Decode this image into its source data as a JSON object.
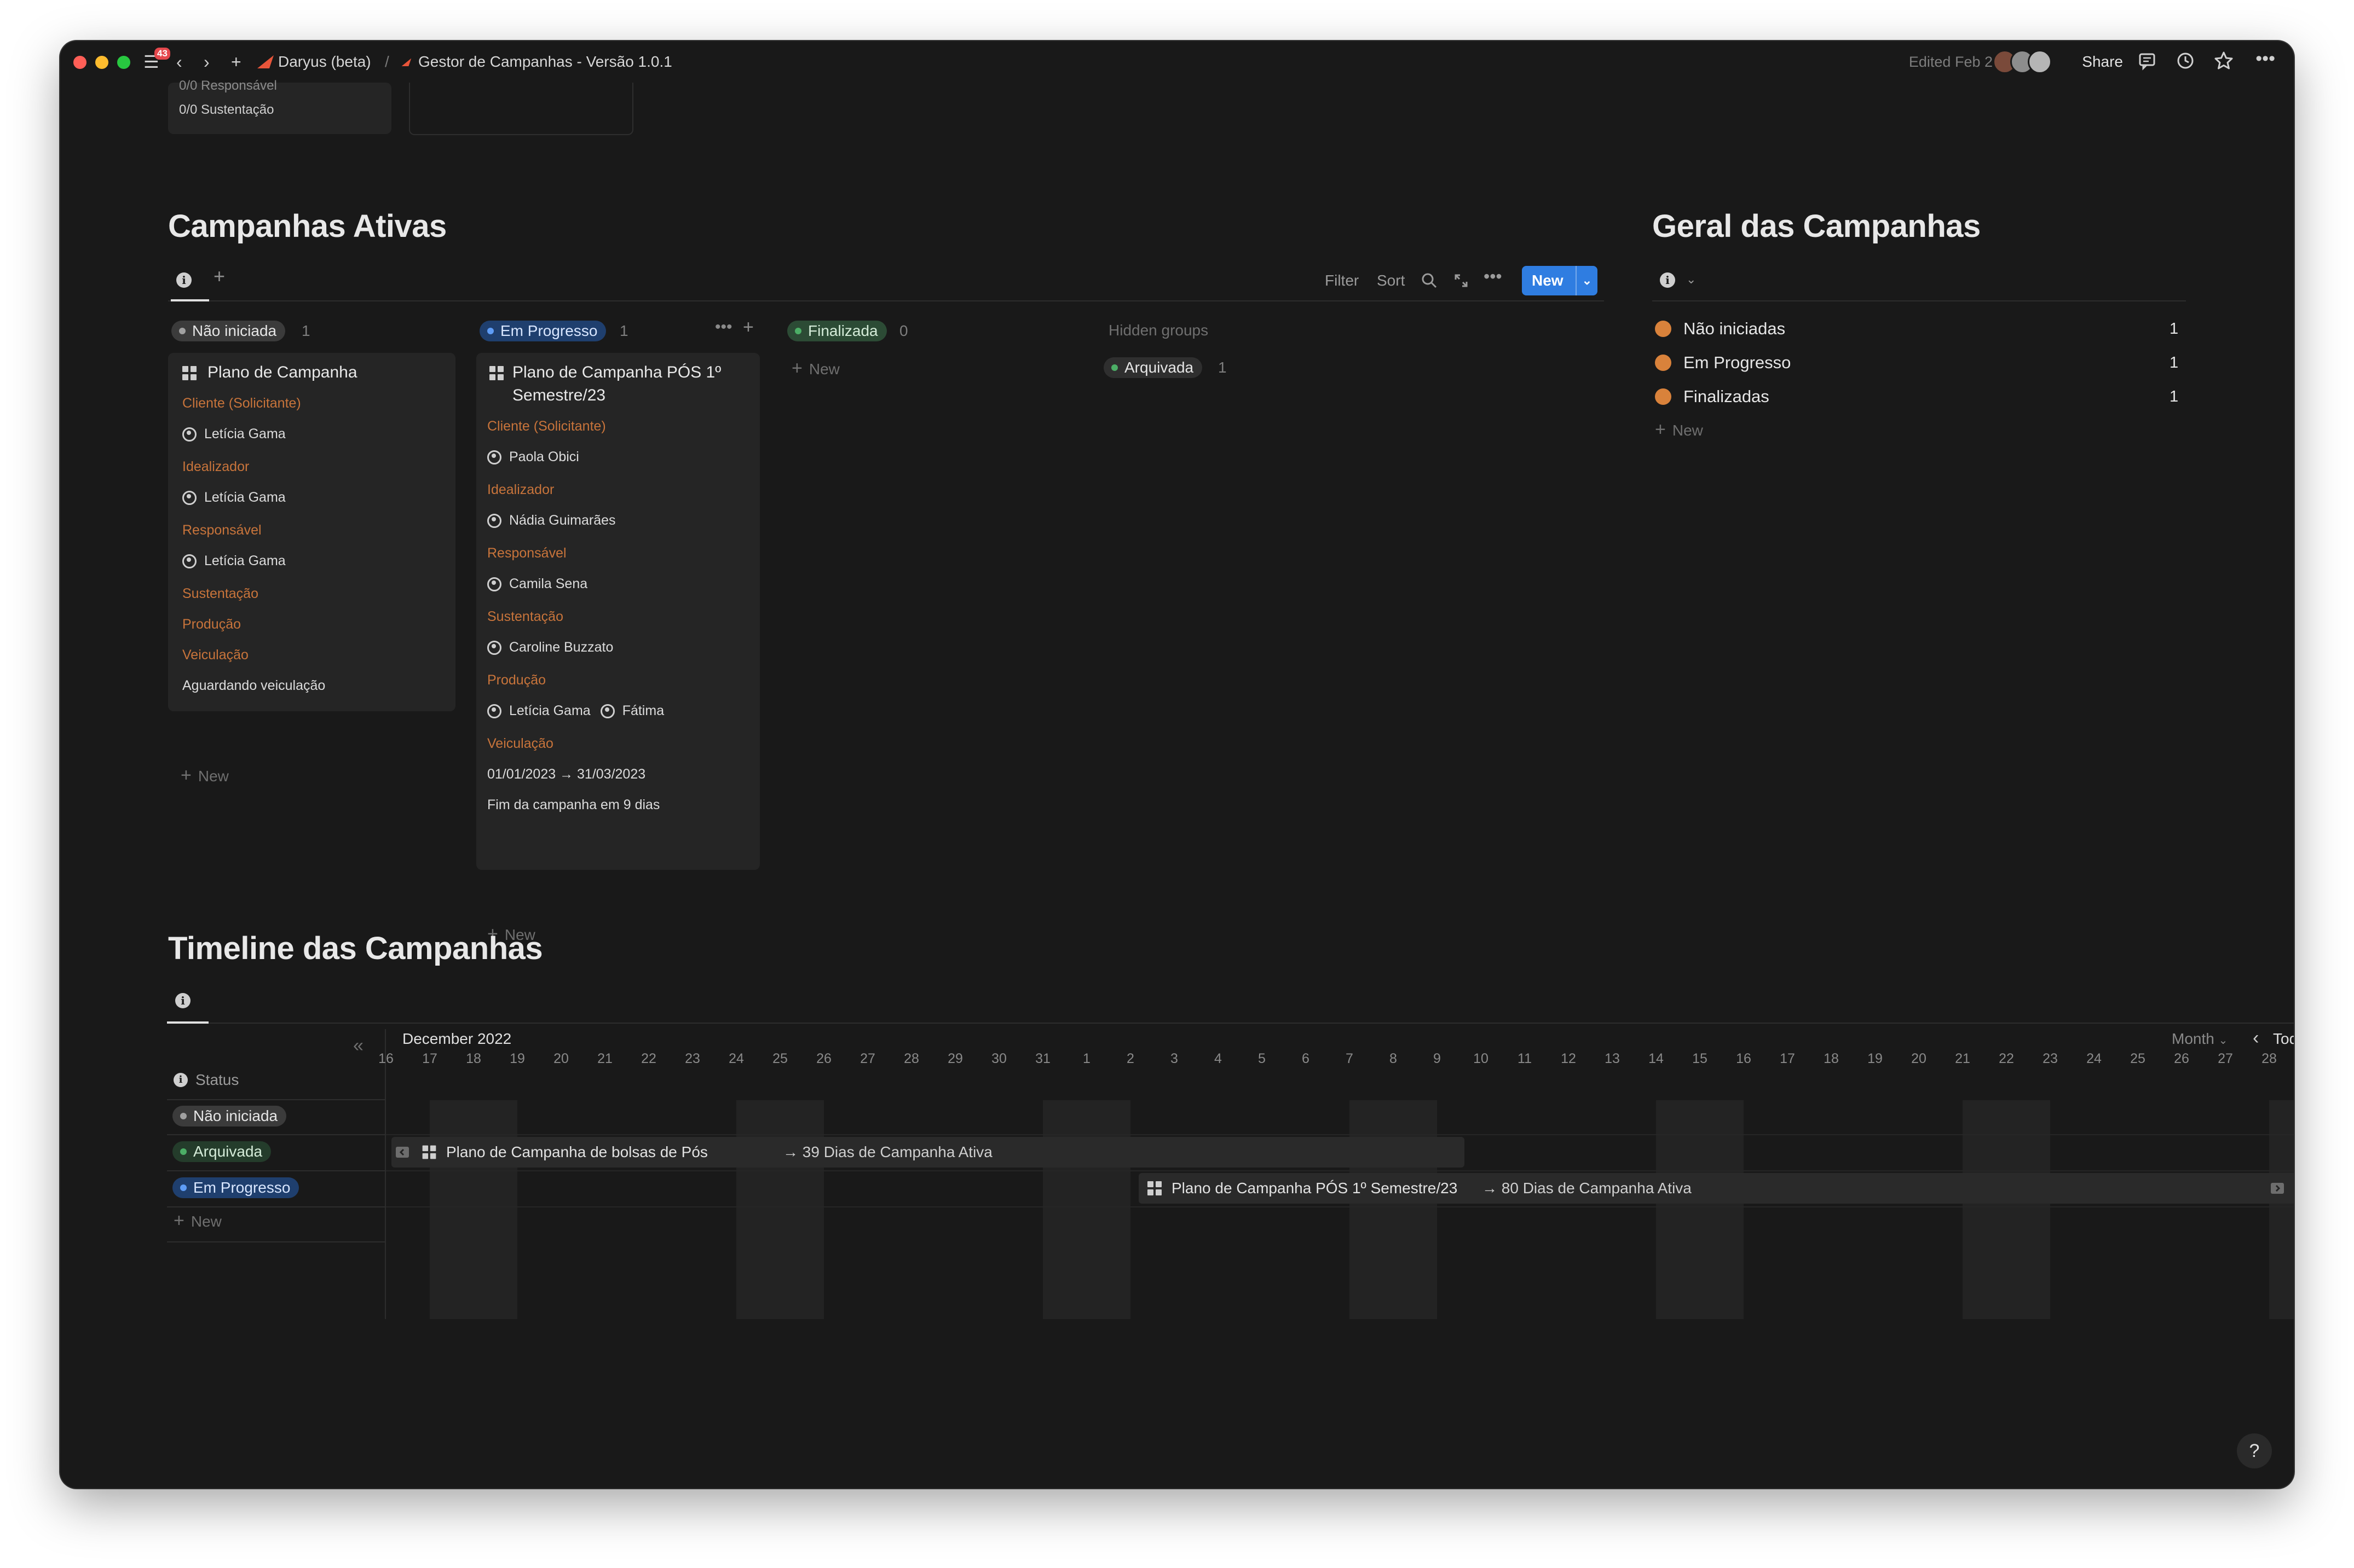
{
  "titlebar": {
    "notification_count": "43",
    "breadcrumb_workspace": "Daryus (beta)",
    "breadcrumb_sep": "/",
    "breadcrumb_page": "Gestor de Campanhas - Versão 1.0.1",
    "edited": "Edited Feb 2",
    "share_label": "Share"
  },
  "top_cards": {
    "line1": "0/0 Responsável",
    "line2": "0/0 Sustentação"
  },
  "campanhas_ativas": {
    "title": "Campanhas Ativas",
    "toolbar": {
      "filter": "Filter",
      "sort": "Sort",
      "new": "New"
    },
    "groups": [
      {
        "label": "Não iniciada",
        "count": "1"
      },
      {
        "label": "Em Progresso",
        "count": "1"
      },
      {
        "label": "Finalizada",
        "count": "0"
      }
    ],
    "hidden_groups": {
      "label": "Hidden groups",
      "items": [
        {
          "label": "Arquivada",
          "count": "1"
        }
      ]
    },
    "new_label": "New",
    "cards": [
      {
        "title": "Plano de Campanha",
        "props": [
          {
            "label": "Cliente (Solicitante)",
            "value": "Letícia Gama"
          },
          {
            "label": "Idealizador",
            "value": "Letícia Gama"
          },
          {
            "label": "Responsável",
            "value": "Letícia Gama"
          },
          {
            "label": "Sustentação"
          },
          {
            "label": "Produção"
          },
          {
            "label": "Veiculação",
            "value": "Aguardando veiculação"
          }
        ]
      },
      {
        "title_line1": "Plano de Campanha PÓS 1º",
        "title_line2": "Semestre/23",
        "props": [
          {
            "label": "Cliente (Solicitante)",
            "value": "Paola Obici"
          },
          {
            "label": "Idealizador",
            "value": "Nádia Guimarães"
          },
          {
            "label": "Responsável",
            "value": "Camila Sena"
          },
          {
            "label": "Sustentação",
            "value": "Caroline Buzzato"
          },
          {
            "label": "Produção",
            "value": "Letícia Gama",
            "value2": "Fátima"
          },
          {
            "label": "Veiculação",
            "value": "01/01/2023 → 31/03/2023",
            "value2": "Fim da campanha em 9 dias"
          }
        ]
      }
    ]
  },
  "geral": {
    "title": "Geral das Campanhas",
    "rows": [
      {
        "label": "Não iniciadas",
        "count": "1"
      },
      {
        "label": "Em Progresso",
        "count": "1"
      },
      {
        "label": "Finalizadas",
        "count": "1"
      }
    ],
    "new_label": "New"
  },
  "timeline": {
    "title": "Timeline das Campanhas",
    "month_label": "December 2022",
    "view": "Month",
    "today": "Today",
    "status_header": "Status",
    "groups": [
      "Não iniciada",
      "Arquivada",
      "Em Progresso"
    ],
    "new_label": "New",
    "days": [
      "16",
      "17",
      "18",
      "19",
      "20",
      "21",
      "22",
      "23",
      "24",
      "25",
      "26",
      "27",
      "28",
      "29",
      "30",
      "31",
      "1",
      "2",
      "3",
      "4",
      "5",
      "6",
      "7",
      "8",
      "9",
      "10",
      "11",
      "12",
      "13",
      "14",
      "15",
      "16",
      "17",
      "18",
      "19",
      "20",
      "21",
      "22",
      "23",
      "24",
      "25",
      "26",
      "27",
      "28"
    ],
    "bars": [
      {
        "title": "Plano de Campanha de bolsas de Pós",
        "note": "→ 39 Dias de Campanha Ativa"
      },
      {
        "title": "Plano de Campanha PÓS 1º Semestre/23",
        "note": "→ 80 Dias de Campanha Ativa"
      }
    ]
  },
  "help_label": "?"
}
